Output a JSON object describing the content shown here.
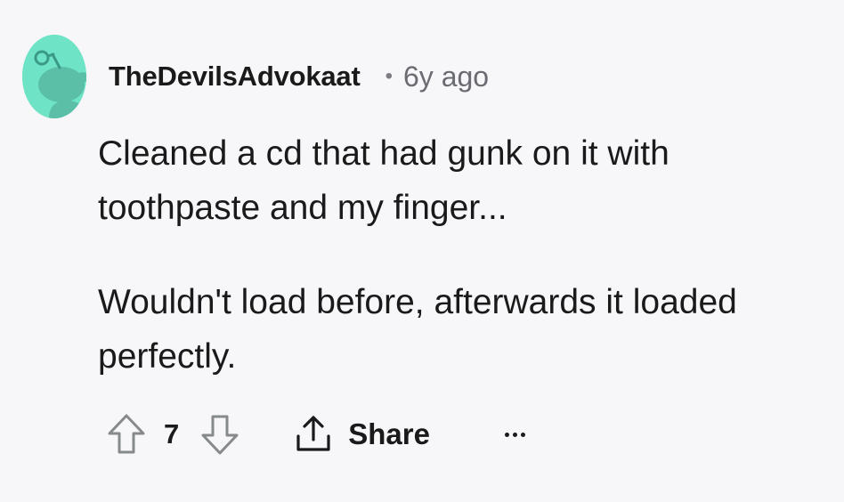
{
  "comment": {
    "username": "TheDevilsAdvokaat",
    "separator": "•",
    "timestamp": "6y ago",
    "paragraphs": [
      "Cleaned a cd that had gunk on it with toothpaste and my finger...",
      "Wouldn't load before, afterwards it loaded perfectly."
    ],
    "vote_count": "7",
    "share_label": "Share"
  },
  "icons": {
    "avatar": "reddit-snoo-avatar-icon",
    "upvote": "arrow-up-outline-icon",
    "downvote": "arrow-down-outline-icon",
    "share": "share-upload-icon",
    "more": "ellipsis-icon"
  },
  "colors": {
    "background": "#f7f7f9",
    "avatar_bg": "#6fe3c5",
    "text_primary": "#1a1a1b",
    "text_secondary": "#6a6c72",
    "icon_gray": "#878a8c"
  }
}
